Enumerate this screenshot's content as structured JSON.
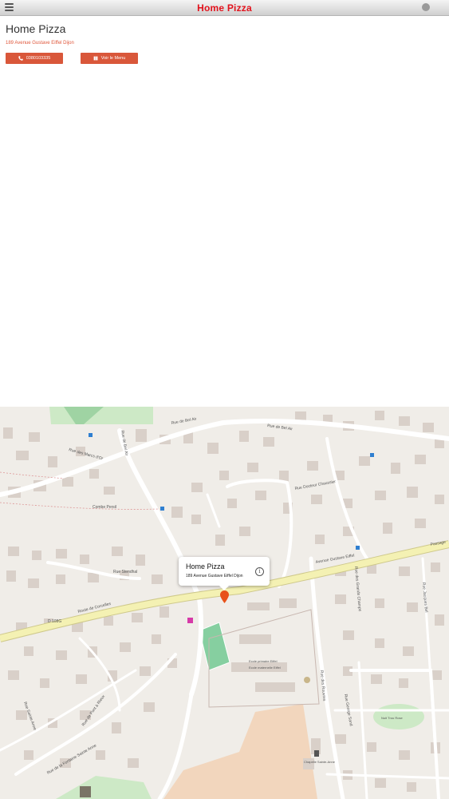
{
  "topbar": {
    "title": "Home Pizza"
  },
  "restaurant": {
    "name": "Home Pizza",
    "address": "189 Avenue Gustave Eiffel Dijon",
    "phone_label": "0380103335",
    "menu_label": "Voir le Menu"
  },
  "map": {
    "callout_title": "Home Pizza",
    "callout_address": "189 Avenue Gustave Eiffel Dijon",
    "streets": {
      "rue_bel_air_1": "Rue de Bel Air",
      "rue_bel_air_2": "Rue de Bel Air",
      "rue_bel_air_3": "Rue de Bel Air",
      "rue_docteur": "Rue Docteur Chaussier",
      "rue_des_marcs": "Rue des Marcs d'Or",
      "combe_persil": "Combe Persil",
      "rue_stendhal": "Rue Stendhal",
      "route_corcelles": "Route de Corcelles",
      "avenue_eiffel": "Avenue Gustave Eiffel",
      "passage": "Passage",
      "d108g": "D 108G",
      "rue_rouvres": "Rue des Rouvres",
      "rue_pont": "Rue de Pont à Rieux",
      "rue_fontaine": "Rue de la Fontaine Sainte Anne",
      "rue_sainte_anne": "Rue Sainte Anne",
      "rue_grands_champs": "Rue des Grands Champs",
      "ecole": "Ecole primaire Eiffel",
      "ecole2": "Ecole maternelle Eiffel",
      "chapelle": "Chapelle Sainte-Anne",
      "nuit": "Nuit Trou Rose",
      "rue_george": "Rue George Sand",
      "rue_jacques": "Rue Jacques Bel"
    }
  },
  "colors": {
    "accent": "#d9573a",
    "brand_red": "#e2121c",
    "road_major": "#f4f1b3",
    "park": "#9fd3a3"
  }
}
